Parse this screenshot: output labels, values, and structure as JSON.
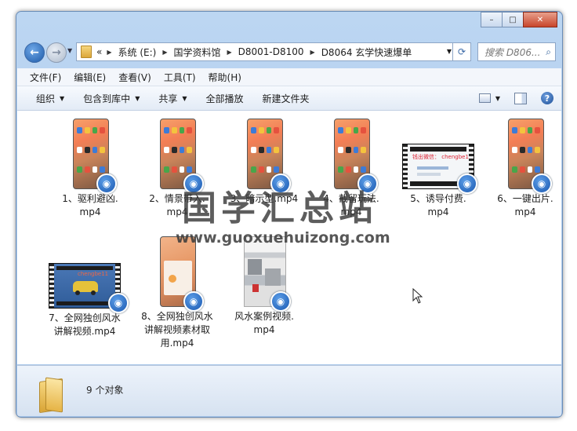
{
  "window": {
    "buttons": {
      "minimize": "–",
      "maximize": "□",
      "close": "✕"
    }
  },
  "nav": {
    "back_symbol": "←",
    "forward_symbol": "→",
    "breadcrumb_overflow": "«",
    "breadcrumbs": [
      "系统 (E:)",
      "国学资料馆",
      "D8001-D8100",
      "D8064 玄学快速爆单"
    ],
    "search_placeholder": "搜索 D806..."
  },
  "menubar": [
    "文件(F)",
    "编辑(E)",
    "查看(V)",
    "工具(T)",
    "帮助(H)"
  ],
  "toolbar": {
    "organize": "组织",
    "include_library": "包含到库中",
    "share": "共享",
    "play_all": "全部播放",
    "new_folder": "新建文件夹",
    "help": "?"
  },
  "files": [
    {
      "line1": "1、驱利避凶.",
      "line2": "mp4",
      "line3": "",
      "thumb": "phone"
    },
    {
      "line1": "2、情景带入.",
      "line2": "mp4",
      "line3": "",
      "thumb": "phone"
    },
    {
      "line1": "3、暗示型.mp4",
      "line2": "",
      "line3": "",
      "thumb": "phone"
    },
    {
      "line1": "4、截留玩法.",
      "line2": "mp4",
      "line3": "",
      "thumb": "phone"
    },
    {
      "line1": "5、诱导付费.",
      "line2": "mp4",
      "line3": "",
      "thumb": "film-chat",
      "overlay_text": "钱出微信： chengbe11"
    },
    {
      "line1": "6、一键出片.",
      "line2": "mp4",
      "line3": "",
      "thumb": "phone"
    },
    {
      "line1": "7、全网独创风水",
      "line2": "讲解视频.mp4",
      "line3": "",
      "thumb": "film-desktop",
      "overlay_text": "chengbe11"
    },
    {
      "line1": "8、全网独创风水",
      "line2": "讲解视频素材取",
      "line3": "用.mp4",
      "thumb": "phone-light"
    },
    {
      "line1": "风水案例视频.",
      "line2": "mp4",
      "line3": "",
      "thumb": "photo"
    }
  ],
  "status": {
    "count": "9 个对象"
  },
  "watermark": {
    "cn": "国学汇总站",
    "en": "www.guoxuehuizong.com"
  },
  "colors": {
    "accent": "#1a58b0",
    "title_bar": "#bcd6f2"
  }
}
